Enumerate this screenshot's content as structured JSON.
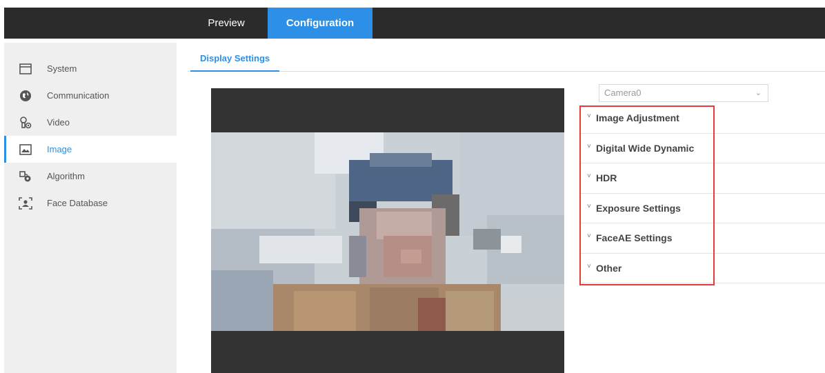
{
  "topnav": {
    "tabs": [
      {
        "label": "Preview",
        "active": false
      },
      {
        "label": "Configuration",
        "active": true
      }
    ]
  },
  "sidebar": {
    "items": [
      {
        "label": "System",
        "icon": "system-icon"
      },
      {
        "label": "Communication",
        "icon": "globe-icon"
      },
      {
        "label": "Video",
        "icon": "video-icon"
      },
      {
        "label": "Image",
        "icon": "image-icon",
        "active": true
      },
      {
        "label": "Algorithm",
        "icon": "algorithm-icon"
      },
      {
        "label": "Face Database",
        "icon": "face-database-icon"
      }
    ]
  },
  "subtabs": {
    "display_settings": "Display Settings"
  },
  "camera": {
    "selected": "Camera0"
  },
  "sections": [
    {
      "label": "Image Adjustment"
    },
    {
      "label": "Digital Wide Dynamic"
    },
    {
      "label": "HDR"
    },
    {
      "label": "Exposure Settings"
    },
    {
      "label": "FaceAE Settings"
    },
    {
      "label": "Other"
    }
  ],
  "colors": {
    "accent": "#2e8fe6",
    "topbar": "#2b2b2b",
    "highlight": "#e53935"
  }
}
